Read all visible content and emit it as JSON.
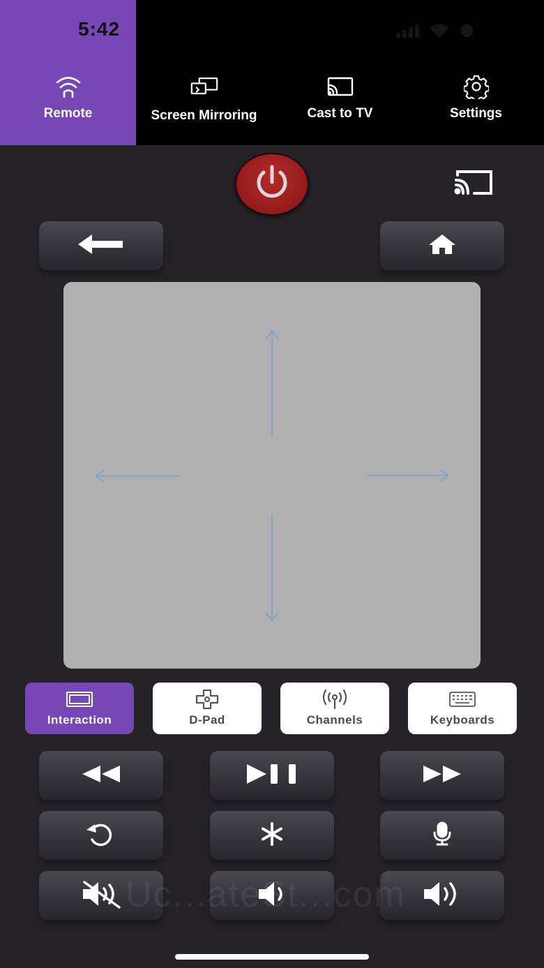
{
  "status_bar": {
    "time": "5:42"
  },
  "nav": {
    "tabs": [
      {
        "label": "Remote",
        "icon": "wifi-remote-icon",
        "active": true
      },
      {
        "label": "Screen Mirroring",
        "icon": "screen-mirroring-icon",
        "active": false
      },
      {
        "label": "Cast to TV",
        "icon": "cast-icon",
        "active": false
      },
      {
        "label": "Settings",
        "icon": "gear-icon",
        "active": false
      }
    ]
  },
  "remote": {
    "power_icon": "power-icon",
    "cast_icon": "cast-icon",
    "back_icon": "back-arrow-icon",
    "home_icon": "home-icon"
  },
  "modes": [
    {
      "label": "Interaction",
      "icon": "screen-icon",
      "active": true
    },
    {
      "label": "D-Pad",
      "icon": "dpad-icon",
      "active": false
    },
    {
      "label": "Channels",
      "icon": "broadcast-icon",
      "active": false
    },
    {
      "label": "Keyboards",
      "icon": "keyboard-icon",
      "active": false
    }
  ],
  "colors": {
    "accent": "#7747b5",
    "power": "#a52222",
    "background": "#252328",
    "touchpad": "#b0b0b1"
  },
  "watermark": "Uc...ateSt...com"
}
